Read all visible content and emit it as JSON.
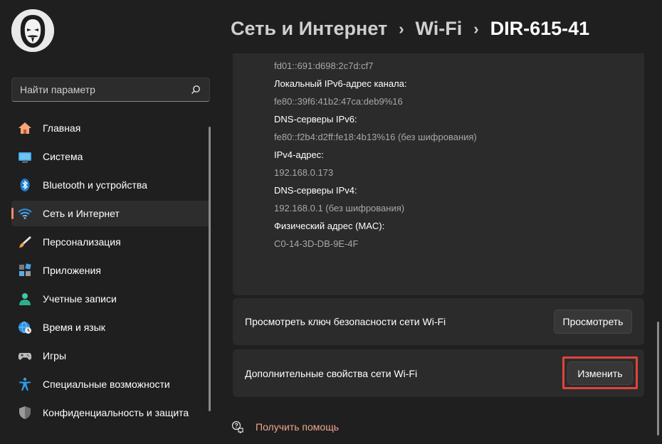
{
  "search": {
    "placeholder": "Найти параметр"
  },
  "sidebar": {
    "items": [
      {
        "label": "Главная",
        "icon": "home-icon"
      },
      {
        "label": "Система",
        "icon": "monitor-icon"
      },
      {
        "label": "Bluetooth и устройства",
        "icon": "bluetooth-icon"
      },
      {
        "label": "Сеть и Интернет",
        "icon": "wifi-icon",
        "active": true
      },
      {
        "label": "Персонализация",
        "icon": "brush-icon"
      },
      {
        "label": "Приложения",
        "icon": "apps-icon"
      },
      {
        "label": "Учетные записи",
        "icon": "person-icon"
      },
      {
        "label": "Время и язык",
        "icon": "globe-clock-icon"
      },
      {
        "label": "Игры",
        "icon": "gamepad-icon"
      },
      {
        "label": "Специальные возможности",
        "icon": "accessibility-icon"
      },
      {
        "label": "Конфиденциальность и защита",
        "icon": "shield-icon"
      }
    ]
  },
  "header": {
    "crumb1": "Сеть и Интернет",
    "crumb2": "Wi-Fi",
    "current": "DIR-615-41"
  },
  "properties": {
    "ipv6_value_partial": "fd01::691:d698:2c7d:cf7",
    "linklocal_label": "Локальный IPv6-адрес канала:",
    "linklocal_value": "fe80::39f6:41b2:47ca:deb9%16",
    "dns6_label": "DNS-серверы IPv6:",
    "dns6_value": "fe80::f2b4:d2ff:fe18:4b13%16 (без шифрования)",
    "ipv4_label": "IPv4-адрес:",
    "ipv4_value": "192.168.0.173",
    "dns4_label": "DNS-серверы IPv4:",
    "dns4_value": "192.168.0.1 (без шифрования)",
    "mac_label": "Физический адрес (MAC):",
    "mac_value": "C0-14-3D-DB-9E-4F"
  },
  "security_key": {
    "text": "Просмотреть ключ безопасности сети Wi-Fi",
    "button": "Просмотреть"
  },
  "advanced": {
    "text": "Дополнительные свойства сети Wi-Fi",
    "button": "Изменить"
  },
  "help": {
    "label": "Получить помощь"
  },
  "colors": {
    "accent": "#f08a70",
    "highlight": "#e0443e",
    "background": "#1f1f1f",
    "card": "#2b2b2b"
  }
}
